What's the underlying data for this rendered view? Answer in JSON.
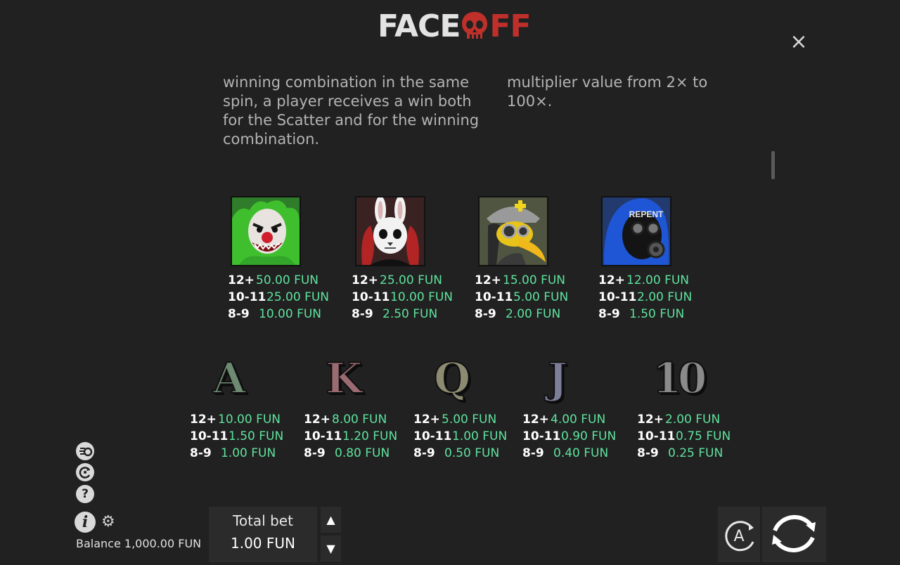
{
  "logo": {
    "face": "FACE",
    "off": "FF"
  },
  "close_label": "×",
  "description": {
    "left": "winning combination in the same spin, a player receives a win both for the Scatter and for the winning combination.",
    "right": "multiplier value from 2× to 100×."
  },
  "premium_symbols": [
    {
      "name": "clown",
      "pays": [
        {
          "count": "12+",
          "value": "50.00 FUN"
        },
        {
          "count": "10-11",
          "value": "25.00 FUN"
        },
        {
          "count": "8-9",
          "value": "10.00 FUN"
        }
      ]
    },
    {
      "name": "rabbit-mask",
      "pays": [
        {
          "count": "12+",
          "value": "25.00 FUN"
        },
        {
          "count": "10-11",
          "value": "10.00 FUN"
        },
        {
          "count": "8-9",
          "value": "2.50 FUN"
        }
      ]
    },
    {
      "name": "plague-doctor",
      "pays": [
        {
          "count": "12+",
          "value": "15.00 FUN"
        },
        {
          "count": "10-11",
          "value": "5.00 FUN"
        },
        {
          "count": "8-9",
          "value": "2.00 FUN"
        }
      ]
    },
    {
      "name": "gas-mask",
      "badge": "REPENT",
      "pays": [
        {
          "count": "12+",
          "value": "12.00 FUN"
        },
        {
          "count": "10-11",
          "value": "2.00 FUN"
        },
        {
          "count": "8-9",
          "value": "1.50 FUN"
        }
      ]
    }
  ],
  "letter_symbols": [
    {
      "glyph": "A",
      "color": "#6e8a72",
      "pays": [
        {
          "count": "12+",
          "value": "10.00 FUN"
        },
        {
          "count": "10-11",
          "value": "1.50 FUN"
        },
        {
          "count": "8-9",
          "value": "1.00 FUN"
        }
      ]
    },
    {
      "glyph": "K",
      "color": "#9b6b72",
      "pays": [
        {
          "count": "12+",
          "value": "8.00 FUN"
        },
        {
          "count": "10-11",
          "value": "1.20 FUN"
        },
        {
          "count": "8-9",
          "value": "0.80 FUN"
        }
      ]
    },
    {
      "glyph": "Q",
      "color": "#8c8a70",
      "pays": [
        {
          "count": "12+",
          "value": "5.00 FUN"
        },
        {
          "count": "10-11",
          "value": "1.00 FUN"
        },
        {
          "count": "8-9",
          "value": "0.50 FUN"
        }
      ]
    },
    {
      "glyph": "J",
      "color": "#7d7f99",
      "pays": [
        {
          "count": "12+",
          "value": "4.00 FUN"
        },
        {
          "count": "10-11",
          "value": "0.90 FUN"
        },
        {
          "count": "8-9",
          "value": "0.40 FUN"
        }
      ]
    },
    {
      "glyph": "10",
      "color": "#8a8a8a",
      "pays": [
        {
          "count": "12+",
          "value": "2.00 FUN"
        },
        {
          "count": "10-11",
          "value": "0.75 FUN"
        },
        {
          "count": "8-9",
          "value": "0.25 FUN"
        }
      ]
    }
  ],
  "sidebar": {
    "info": "i",
    "help": "?",
    "gear": "⚙"
  },
  "balance_text": "Balance 1,000.00 FUN",
  "bet": {
    "label": "Total bet",
    "value": "1.00 FUN",
    "up": "▲",
    "down": "▼"
  },
  "auto_label": "A",
  "colors": {
    "pay_value": "#5fe29e",
    "logo_red": "#c0302b",
    "background": "#212121"
  }
}
